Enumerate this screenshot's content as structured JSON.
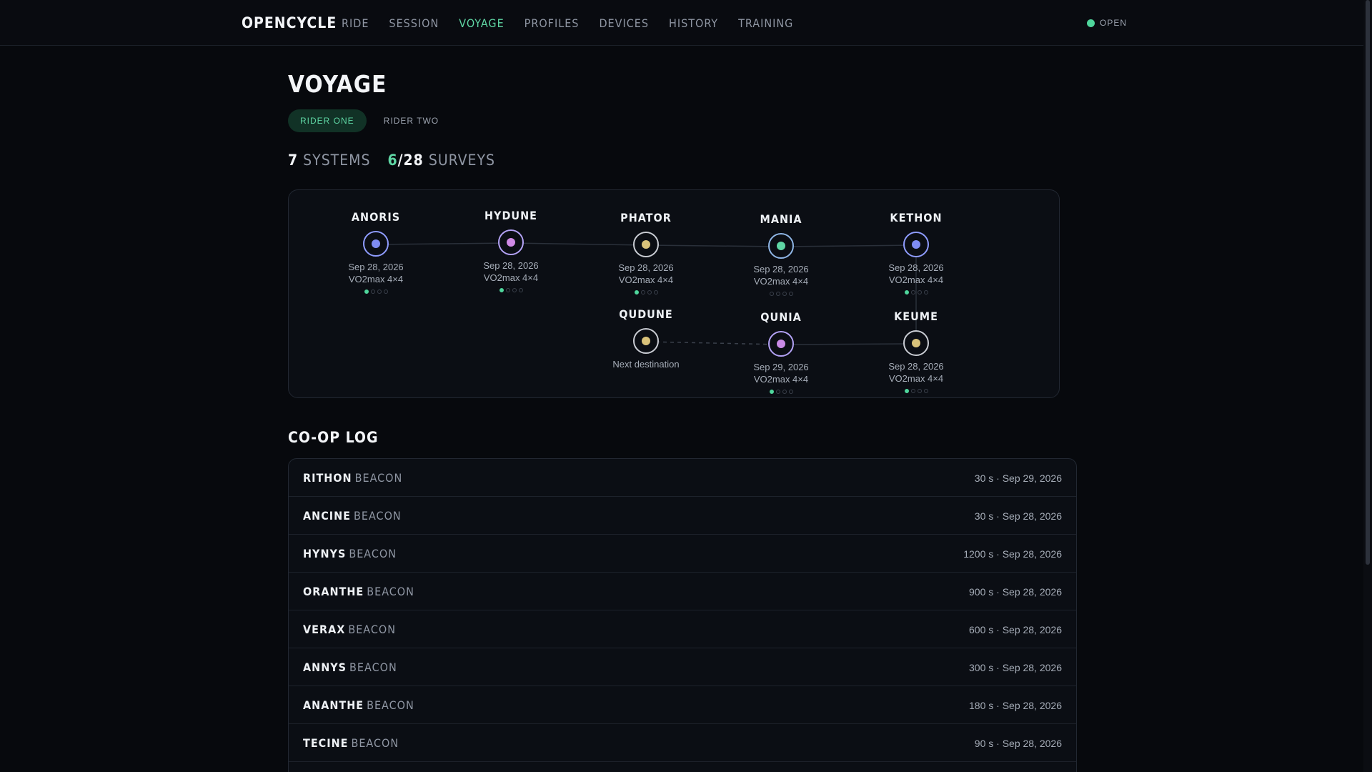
{
  "header": {
    "brand": "OPENCYCLE",
    "nav": [
      "RIDE",
      "SESSION",
      "VOYAGE",
      "PROFILES",
      "DEVICES",
      "HISTORY",
      "TRAINING"
    ],
    "active_nav": "VOYAGE",
    "status": "OPEN",
    "status_color": "#4fd69c"
  },
  "page": {
    "title": "VOYAGE",
    "tabs": [
      "RIDER ONE",
      "RIDER TWO"
    ],
    "active_tab": "RIDER ONE",
    "stats": {
      "systems_count": "7",
      "systems_label": "SYSTEMS",
      "surveys_done": "6",
      "surveys_sep": "/",
      "surveys_total": "28",
      "surveys_label": "SURVEYS"
    }
  },
  "map": {
    "nodes": [
      {
        "name": "ANORIS",
        "date": "Sep 28, 2026",
        "workout": "VO2max 4×4",
        "core_color": "#7f8cf2",
        "ring_color": "#8f9cff",
        "progress": 1
      },
      {
        "name": "HYDUNE",
        "date": "Sep 28, 2026",
        "workout": "VO2max 4×4",
        "core_color": "#d08ae6",
        "ring_color": "#b3a2f5",
        "progress": 1
      },
      {
        "name": "PHATOR",
        "date": "Sep 28, 2026",
        "workout": "VO2max 4×4",
        "core_color": "#d9c27a",
        "ring_color": "#c9ccd3",
        "progress": 1
      },
      {
        "name": "MANIA",
        "date": "Sep 28, 2026",
        "workout": "VO2max 4×4",
        "core_color": "#5fd6a4",
        "ring_color": "#8fb6e6",
        "progress": 0
      },
      {
        "name": "KETHON",
        "date": "Sep 28, 2026",
        "workout": "VO2max 4×4",
        "core_color": "#7f8cf2",
        "ring_color": "#8f9cff",
        "progress": 1
      },
      {
        "name": "QUDUNE",
        "date": "Next destination",
        "workout": "",
        "core_color": "#d9c27a",
        "ring_color": "#c9ccd3",
        "progress": -1
      },
      {
        "name": "QUNIA",
        "date": "Sep 29, 2026",
        "workout": "VO2max 4×4",
        "core_color": "#c98ae6",
        "ring_color": "#b3a2f5",
        "progress": 1
      },
      {
        "name": "KEUME",
        "date": "Sep 28, 2026",
        "workout": "VO2max 4×4",
        "core_color": "#d9c27a",
        "ring_color": "#c9ccd3",
        "progress": 1
      }
    ],
    "survey_slots": 4
  },
  "log": {
    "title": "CO-OP LOG",
    "rows": [
      {
        "name": "RITHON",
        "suffix": "BEACON",
        "meta": "30 s · Sep 29, 2026"
      },
      {
        "name": "ANCINE",
        "suffix": "BEACON",
        "meta": "30 s · Sep 28, 2026"
      },
      {
        "name": "HYNYS",
        "suffix": "BEACON",
        "meta": "1200 s · Sep 28, 2026"
      },
      {
        "name": "ORANTHE",
        "suffix": "BEACON",
        "meta": "900 s · Sep 28, 2026"
      },
      {
        "name": "VERAX",
        "suffix": "BEACON",
        "meta": "600 s · Sep 28, 2026"
      },
      {
        "name": "ANNYS",
        "suffix": "BEACON",
        "meta": "300 s · Sep 28, 2026"
      },
      {
        "name": "ANANTHE",
        "suffix": "BEACON",
        "meta": "180 s · Sep 28, 2026"
      },
      {
        "name": "TECINE",
        "suffix": "BEACON",
        "meta": "90 s · Sep 28, 2026"
      }
    ]
  }
}
